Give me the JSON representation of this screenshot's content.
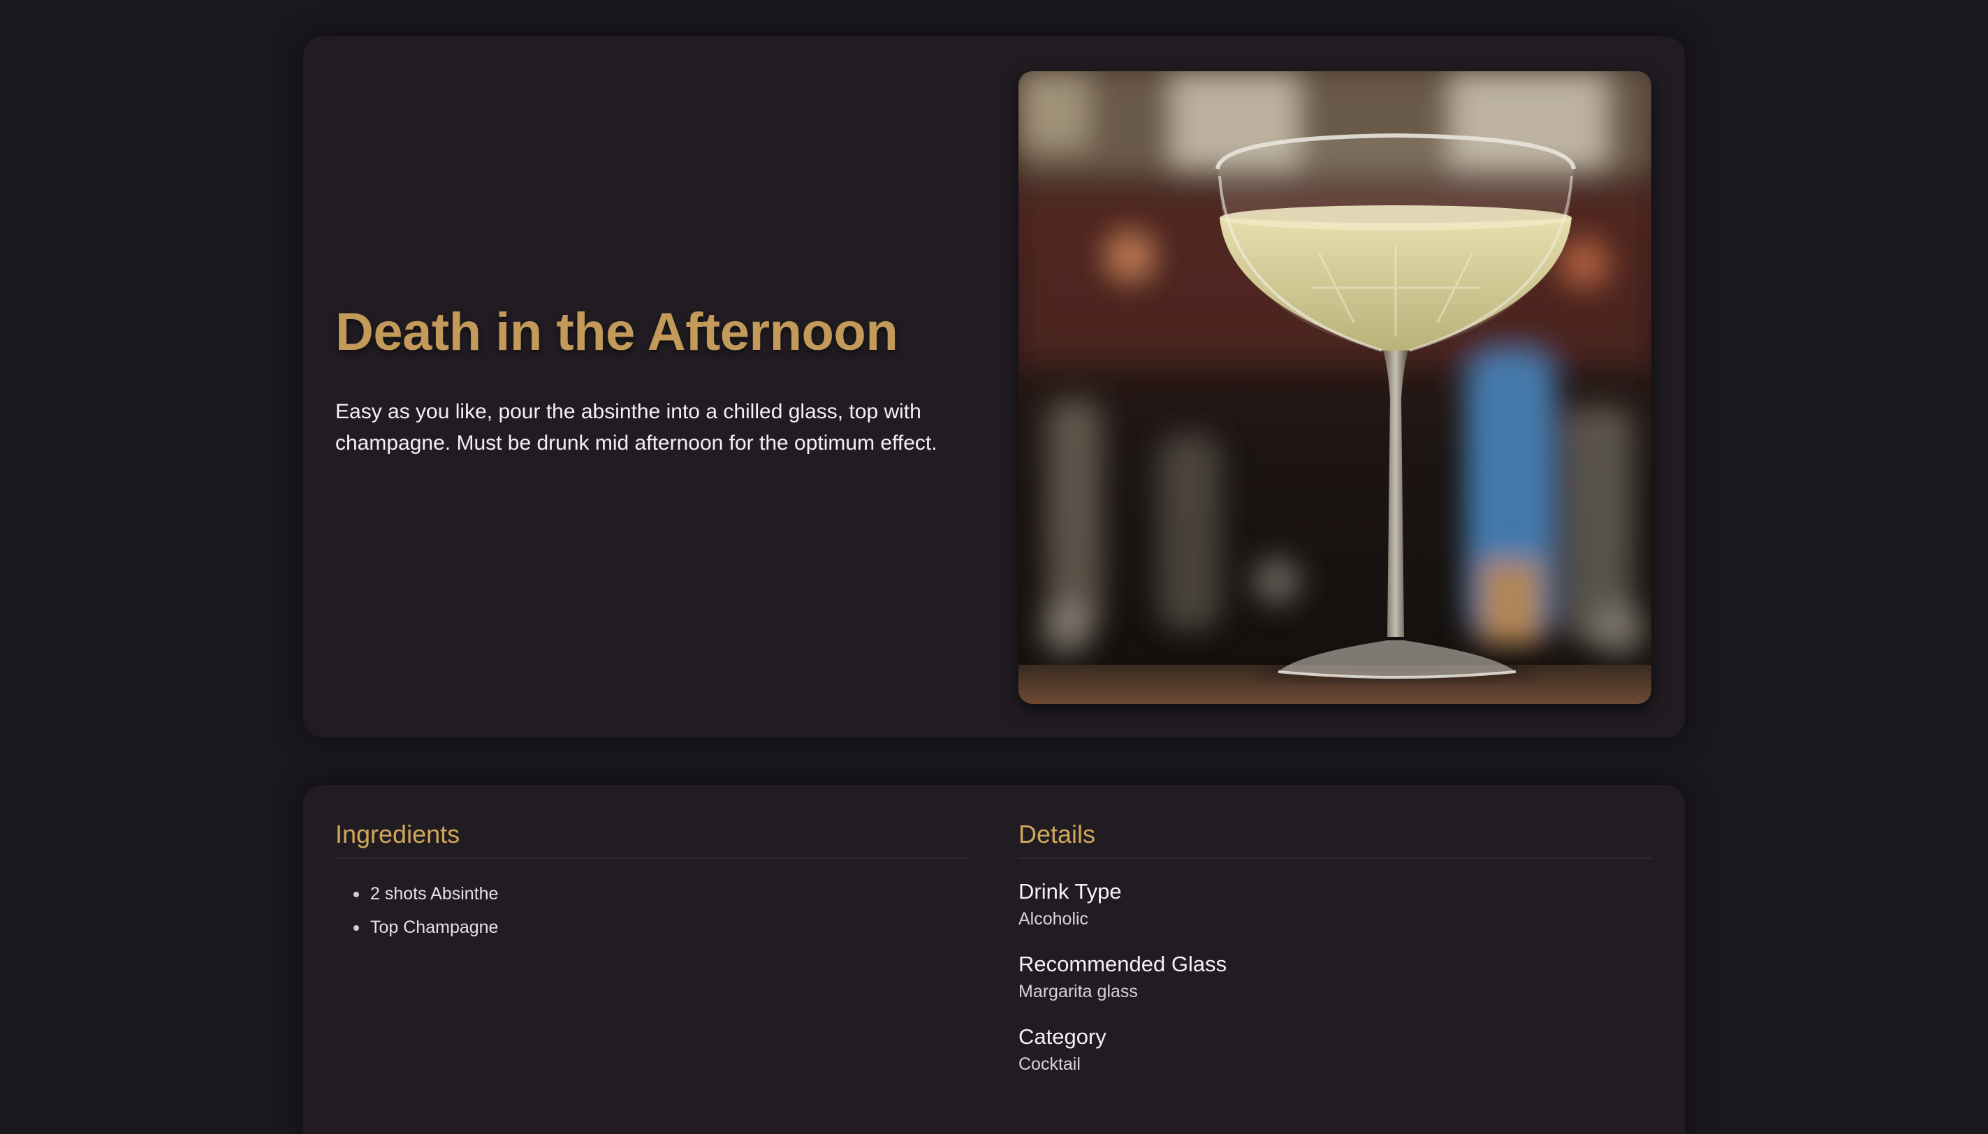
{
  "drink": {
    "name": "Death in the Afternoon",
    "instructions": "Easy as you like, pour the absinthe into a chilled glass, top with champagne. Must be drunk mid afternoon for the optimum effect.",
    "image_alt": "Death in the Afternoon"
  },
  "ingredients": {
    "title": "Ingredients",
    "items": [
      "2 shots Absinthe",
      "Top Champagne"
    ]
  },
  "details": {
    "title": "Details",
    "items": [
      {
        "label": "Drink Type",
        "value": "Alcoholic"
      },
      {
        "label": "Recommended Glass",
        "value": "Margarita glass"
      },
      {
        "label": "Category",
        "value": "Cocktail"
      }
    ]
  },
  "colors": {
    "background": "#1a171d",
    "card": "#201c22",
    "title_gold": "#c49a5a",
    "section_gold": "#d1a85a"
  }
}
